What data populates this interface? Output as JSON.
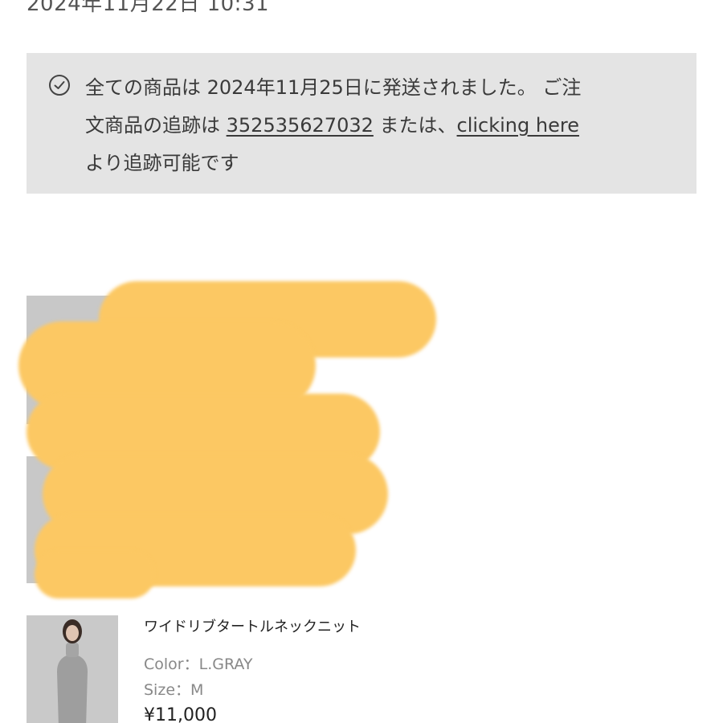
{
  "order": {
    "date": "2024年11月22日 10:31"
  },
  "notice": {
    "icon": "check-circle-icon",
    "line1": "全ての商品は 2024年11月25日に発送されました。 ご注",
    "line2_prefix": "文商品の追跡は ",
    "tracking_number": "352535627032",
    "line2_middle": " または、",
    "link_text": "clicking here",
    "line3": "より追跡可能です"
  },
  "product": {
    "name": "ワイドリブタートルネックニット",
    "color": "Color：L.GRAY",
    "size": "Size：M",
    "price": "¥11,000"
  },
  "colors": {
    "notice_bg": "#e4e4e4",
    "redaction": "#fcc863"
  }
}
